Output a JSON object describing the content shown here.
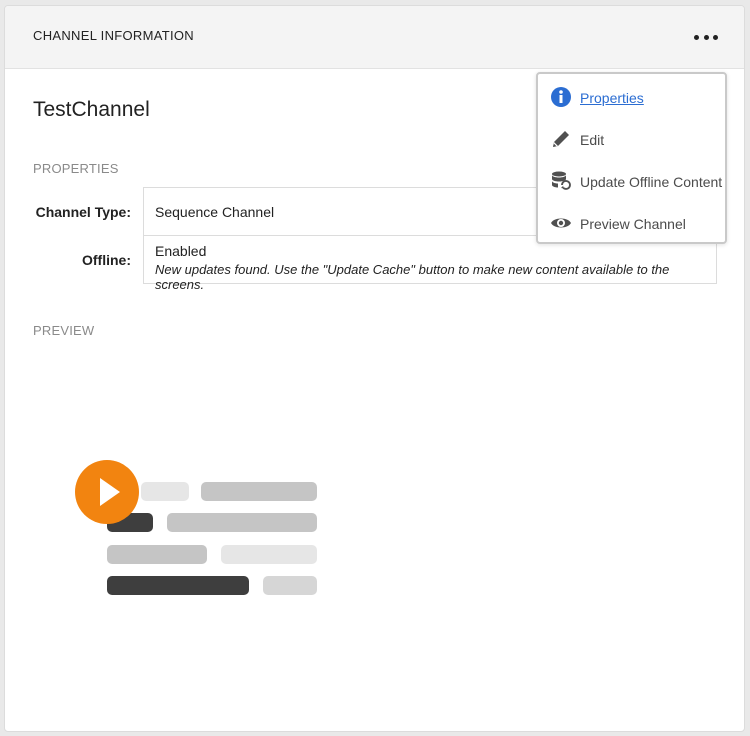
{
  "header": {
    "title": "CHANNEL INFORMATION",
    "more_icon": "more-horizontal-icon"
  },
  "channel": {
    "name": "TestChannel"
  },
  "properties": {
    "section_label": "PROPERTIES",
    "channel_type_label": "Channel Type:",
    "channel_type_value": "Sequence Channel",
    "offline_label": "Offline:",
    "offline_value": "Enabled",
    "offline_note": "New updates found. Use the \"Update Cache\" button to make new content available to the screens."
  },
  "preview": {
    "section_label": "PREVIEW",
    "accent": "#f28410"
  },
  "menu": {
    "items": [
      {
        "label": "Properties",
        "icon": "info-icon",
        "color": "#2b6dd2"
      },
      {
        "label": "Edit",
        "icon": "pencil-icon"
      },
      {
        "label": "Update Offline Content",
        "icon": "database-refresh-icon"
      },
      {
        "label": "Preview Channel",
        "icon": "eye-icon"
      }
    ]
  }
}
